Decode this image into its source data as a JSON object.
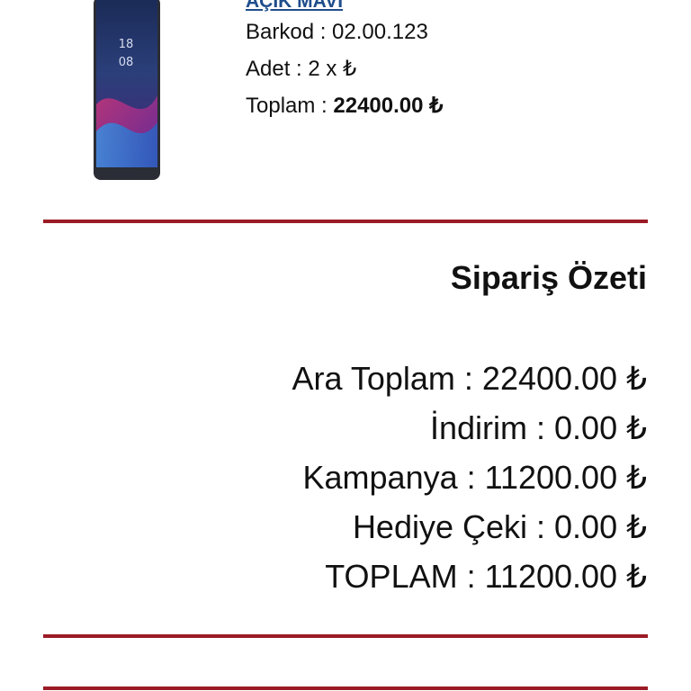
{
  "product": {
    "name": "AÇIK MAVİ",
    "barcode_line": "Barkod : 02.00.123",
    "quantity_line": "Adet : 2 x ₺",
    "total_label": "Toplam : ",
    "total_value": "22400.00 ₺",
    "phone_clock_hour": "18",
    "phone_clock_min": "08"
  },
  "summary": {
    "title": "Sipariş Özeti",
    "rows": [
      "Ara Toplam : 22400.00 ₺",
      "İndirim : 0.00 ₺",
      "Kampanya : 11200.00 ₺",
      "Hediye Çeki : 0.00 ₺",
      "TOPLAM : 11200.00 ₺"
    ]
  },
  "colors": {
    "divider": "#9b1b25",
    "product_link": "#1f4d8c",
    "text": "#111111"
  }
}
